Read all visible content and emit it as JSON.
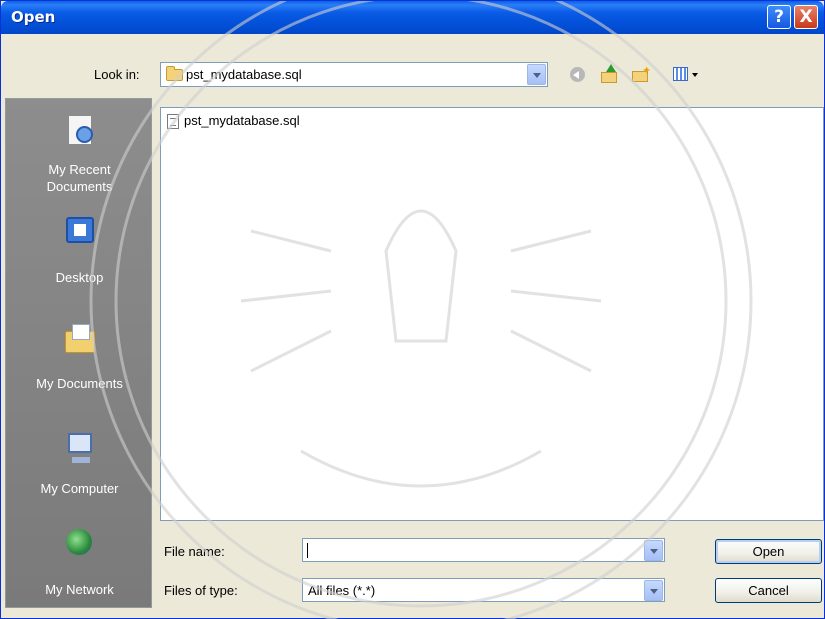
{
  "window": {
    "title": "Open",
    "help_glyph": "?",
    "close_glyph": "X"
  },
  "toolbar": {
    "look_in_label": "Look in:",
    "look_in_value": "pst_mydatabase.sql",
    "icons": [
      "back-icon",
      "up-folder-icon",
      "new-folder-icon",
      "views-menu-icon"
    ]
  },
  "places": [
    {
      "label_line1": "My Recent",
      "label_line2": "Documents",
      "icon": "recent-documents-icon"
    },
    {
      "label_line1": "Desktop",
      "label_line2": "",
      "icon": "desktop-icon"
    },
    {
      "label_line1": "My Documents",
      "label_line2": "",
      "icon": "my-documents-icon"
    },
    {
      "label_line1": "My Computer",
      "label_line2": "",
      "icon": "my-computer-icon"
    },
    {
      "label_line1": "My Network",
      "label_line2": "",
      "icon": "my-network-icon"
    }
  ],
  "files": [
    {
      "name": "pst_mydatabase.sql",
      "icon": "text-file-icon"
    }
  ],
  "form": {
    "file_name_label": "File name:",
    "file_name_value": "",
    "file_type_label": "Files of type:",
    "file_type_value": "All files (*.*)"
  },
  "buttons": {
    "open": "Open",
    "cancel": "Cancel"
  },
  "colors": {
    "titlebar": "#0054e3",
    "dialog_bg": "#ece9d8",
    "places_bar": "#808080",
    "input_border": "#7f9db9"
  }
}
